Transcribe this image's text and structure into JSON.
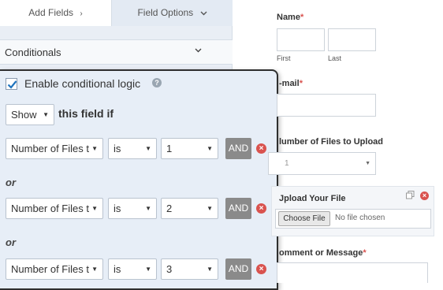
{
  "tabs": {
    "add_fields": "Add Fields",
    "add_fields_icon": "chevron-right-icon",
    "field_options": "Field Options",
    "field_options_icon": "chevron-down-icon"
  },
  "conditionals": {
    "label": "Conditionals",
    "chevron_icon": "chevron-down-icon"
  },
  "logic": {
    "enable_label": "Enable conditional logic",
    "enabled": true,
    "help_icon": "question-circle-icon",
    "action_value": "Show",
    "action_suffix": "this field if",
    "rules": [
      {
        "field": "Number of Files t",
        "operator": "is",
        "value": "1",
        "button": "AND"
      },
      {
        "field": "Number of Files t",
        "operator": "is",
        "value": "2",
        "button": "AND"
      },
      {
        "field": "Number of Files t",
        "operator": "is",
        "value": "3",
        "button": "AND"
      }
    ],
    "or_label": "or",
    "remove_icon": "remove-circle-icon",
    "colors": {
      "and_button": "#8a8a8a",
      "remove": "#d9534f"
    }
  },
  "preview": {
    "name_label": "Name",
    "first_label": "First",
    "last_label": "Last",
    "email_label": "-mail",
    "num_files_label": "lumber of Files to Upload",
    "num_files_value": "1",
    "upload_label": "Jpload Your File",
    "upload_button": "Choose File",
    "upload_status": "No file chosen",
    "duplicate_icon": "duplicate-icon",
    "delete_icon": "delete-circle-icon",
    "comment_label": "omment or Message",
    "required_mark": "*"
  }
}
